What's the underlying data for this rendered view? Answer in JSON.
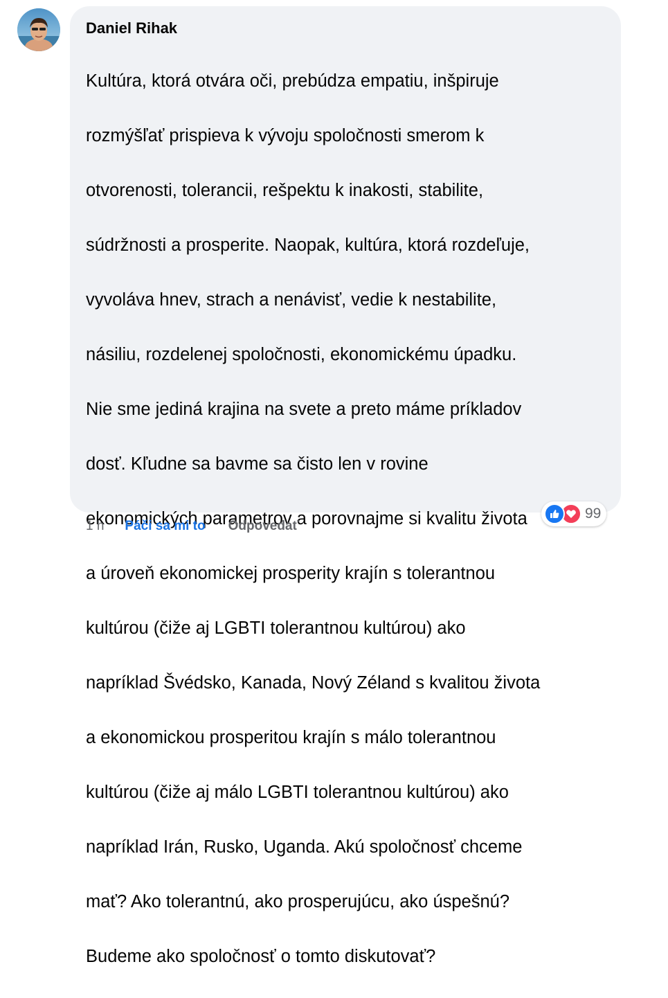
{
  "comment": {
    "author": "Daniel Rihak",
    "text_lines": [
      "Kultúra, ktorá otvára oči, prebúdza empatiu, inšpiruje",
      "rozmýšľať prispieva k vývoju spoločnosti smerom k",
      "otvorenosti, tolerancii, rešpektu k inakosti, stabilite,",
      "súdržnosti a prosperite. Naopak, kultúra, ktorá rozdeľuje,",
      "vyvoláva hnev, strach a nenávisť, vedie k nestabilite,",
      "násiliu, rozdelenej spoločnosti, ekonomickému úpadku.",
      "Nie sme jediná krajina na svete a preto máme príkladov",
      "dosť. Kľudne sa bavme sa čisto len v rovine",
      "ekonomických parametrov a porovnajme si kvalitu života",
      "a úroveň ekonomickej prosperity krajín s tolerantnou",
      "kultúrou (čiže aj LGBTI tolerantnou kultúrou) ako",
      "napríklad Švédsko, Kanada, Nový Zéland s kvalitou života",
      "a ekonomickou prosperitou krajín s málo tolerantnou",
      "kultúrou (čiže aj málo LGBTI tolerantnou kultúrou) ako",
      "napríklad Irán, Rusko, Uganda. Akú spoločnosť chceme",
      "mať? Ako tolerantnú, ako prosperujúcu, ako úspešnú?",
      "Budeme ako spoločnosť o tomto diskutovať?"
    ]
  },
  "actions": {
    "time": "1 h",
    "like_label": "Páči sa mi to",
    "reply_label": "Odpovedať"
  },
  "reactions": {
    "icons": [
      "like-icon",
      "love-icon"
    ],
    "count": "99"
  },
  "colors": {
    "bubble_bg": "#f0f2f5",
    "link_blue": "#1b74e4",
    "secondary_text": "#65676b",
    "like_blue": "#1877f2",
    "love_red": "#f33e58"
  }
}
